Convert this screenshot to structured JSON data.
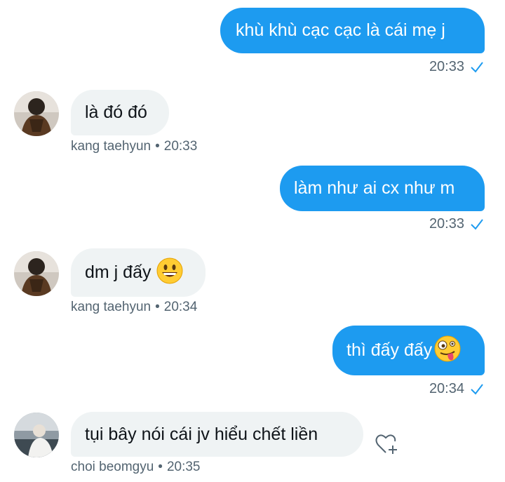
{
  "messages": [
    {
      "text": "khù khù cạc cạc là cái mẹ j",
      "time": "20:33"
    },
    {
      "text": "là đó đó",
      "sender": "kang taehyun",
      "time": "20:33"
    },
    {
      "text": "làm như ai cx như m",
      "time": "20:33"
    },
    {
      "text": "dm j đấy",
      "emoji": "grinning-face",
      "sender": "kang taehyun",
      "time": "20:34"
    },
    {
      "text": "thì đấy đấy",
      "emoji": "zany-face",
      "time": "20:34"
    },
    {
      "text": "tụi bây nói cái jv hiểu chết liền",
      "sender": "choi beomgyu",
      "time": "20:35"
    }
  ],
  "separator": "•",
  "icons": {
    "read_receipt": "checkmark-icon",
    "react": "heart-plus-icon"
  },
  "colors": {
    "outgoing": "#1d9bf0",
    "incoming": "#eff3f4",
    "meta": "#536471"
  }
}
